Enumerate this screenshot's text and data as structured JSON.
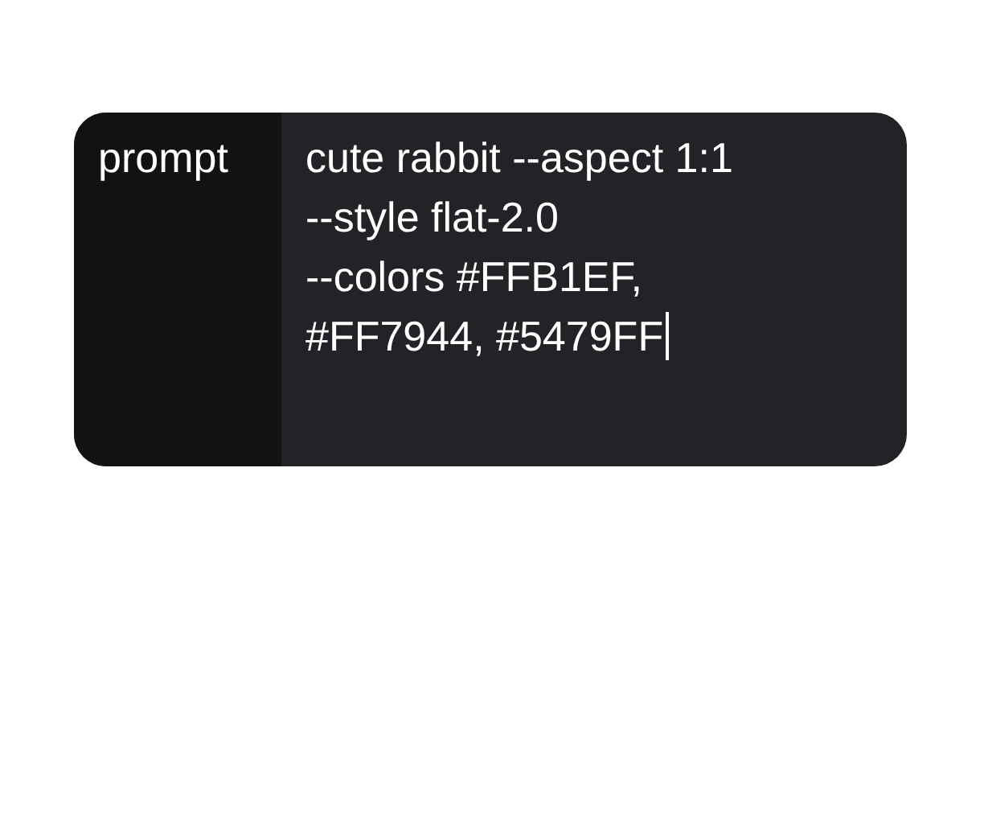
{
  "prompt_field": {
    "label": "prompt",
    "value": "cute rabbit --aspect 1:1\n--style flat-2.0\n--colors #FFB1EF,\n#FF7944, #5479FF",
    "focused": true
  }
}
